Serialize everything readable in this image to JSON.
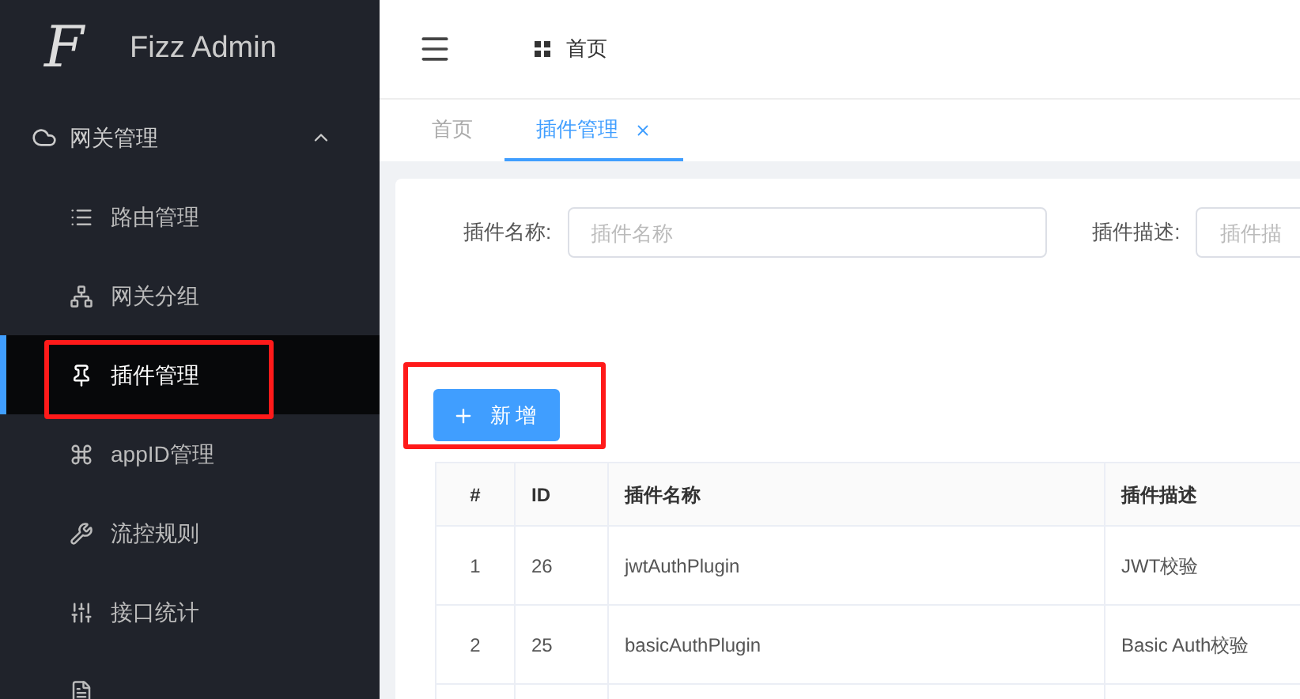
{
  "brand": {
    "title": "Fizz Admin",
    "logo_letter": "F"
  },
  "sidebar": {
    "group": {
      "label": "网关管理",
      "expanded": true
    },
    "items": [
      {
        "label": "路由管理",
        "selected": false
      },
      {
        "label": "网关分组",
        "selected": false
      },
      {
        "label": "插件管理",
        "selected": true
      },
      {
        "label": "appID管理",
        "selected": false
      },
      {
        "label": "流控规则",
        "selected": false
      },
      {
        "label": "接口统计",
        "selected": false
      }
    ]
  },
  "breadcrumb": "首页",
  "tabs": [
    {
      "label": "首页",
      "selected": false,
      "closable": false
    },
    {
      "label": "插件管理",
      "selected": true,
      "closable": true
    }
  ],
  "filters": [
    {
      "label": "插件名称:",
      "placeholder": "插件名称"
    },
    {
      "label": "插件描述:",
      "placeholder": "插件描"
    }
  ],
  "add_button": "新增",
  "table": {
    "columns": [
      "#",
      "ID",
      "插件名称",
      "插件描述"
    ],
    "rows": [
      [
        "1",
        "26",
        "jwtAuthPlugin",
        "JWT校验"
      ],
      [
        "2",
        "25",
        "basicAuthPlugin",
        "Basic Auth校验"
      ]
    ]
  }
}
